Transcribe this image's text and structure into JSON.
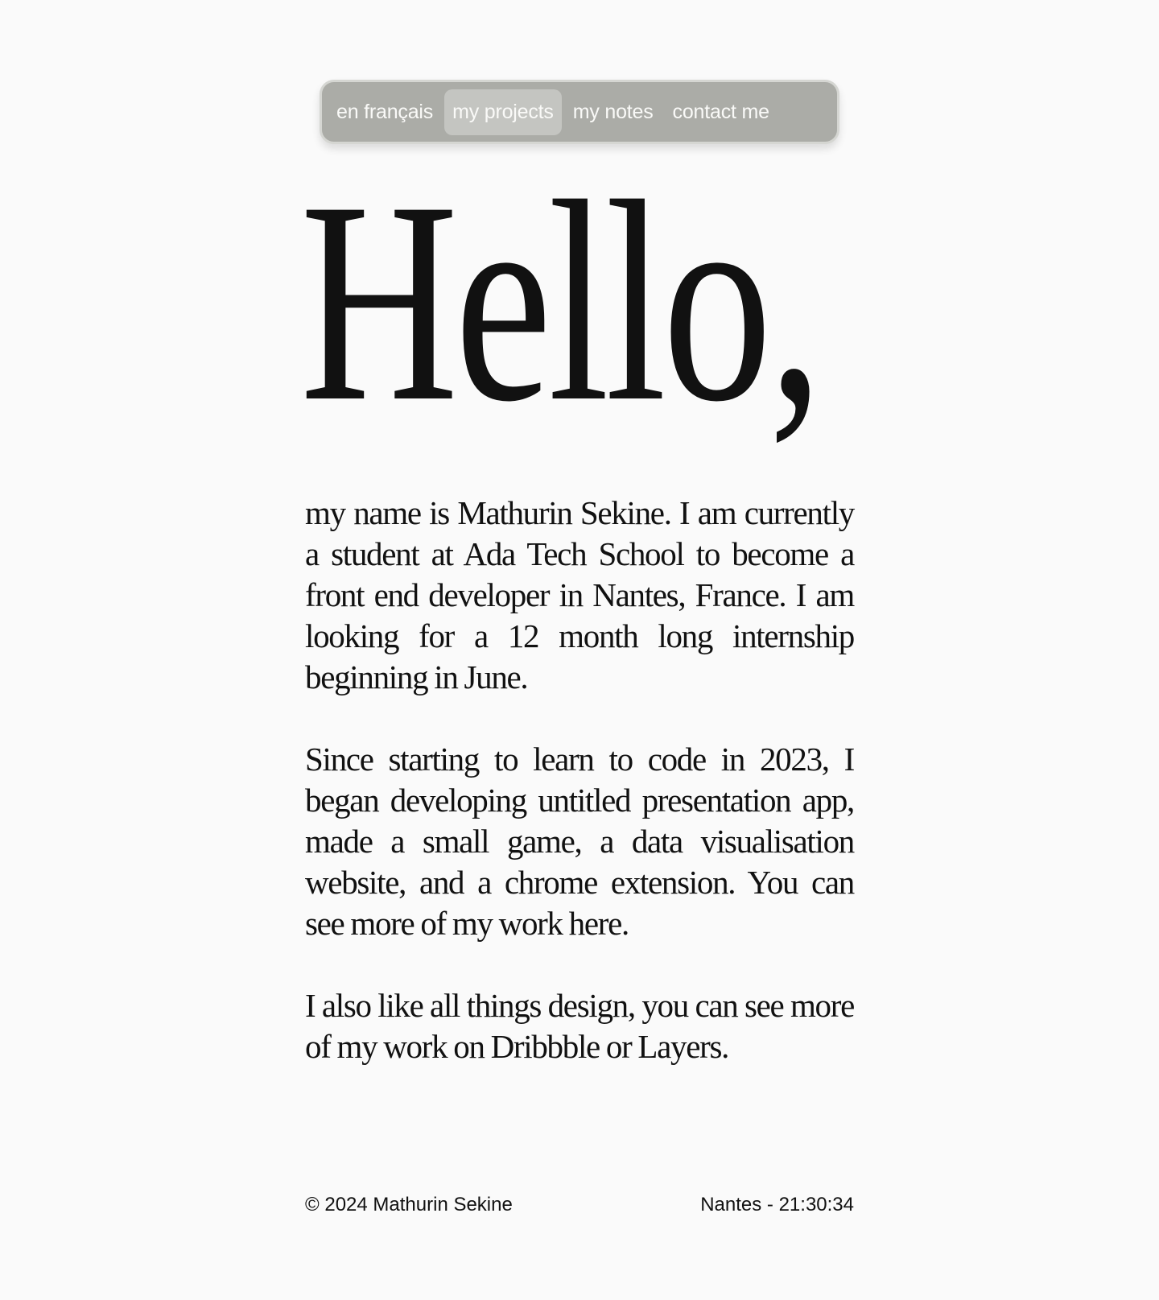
{
  "nav": {
    "items": [
      {
        "label": "en français"
      },
      {
        "label": "my projects"
      },
      {
        "label": "my notes"
      },
      {
        "label": "contact me"
      }
    ]
  },
  "hero": {
    "title": "Hello,"
  },
  "paragraphs": [
    "my name is Mathurin Sekine. I am currently a student at Ada Tech School to become a front end developer in Nantes, France. I am looking for a 12 month long internship beginning in June.",
    "Since starting to learn to code in 2023, I began developing untitled presentation app, made a small game, a data visualisation website, and a chrome extension. You can see more of my work here.",
    "I also like all things design, you can see more of my work on Dribbble or Layers."
  ],
  "footer": {
    "copyright": "© 2024 Mathurin Sekine",
    "location_time": "Nantes - 21:30:34"
  }
}
